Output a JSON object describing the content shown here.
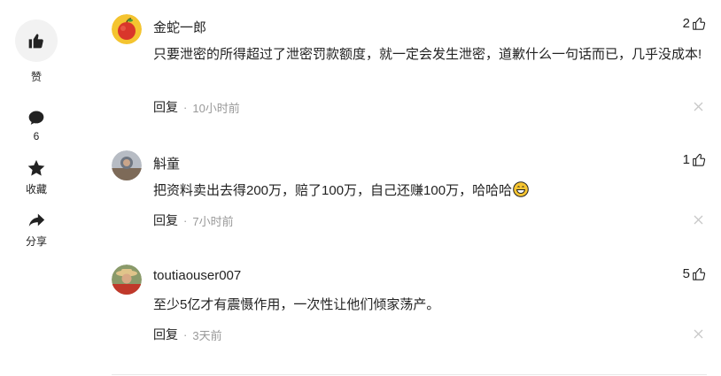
{
  "rail": {
    "like_label": "赞",
    "comment_count": "6",
    "favorite_label": "收藏",
    "share_label": "分享"
  },
  "comments": [
    {
      "user": "金蛇一郎",
      "likes": "2",
      "text": "只要泄密的所得超过了泄密罚款额度，就一定会发生泄密，道歉什么一句话而已，几乎没成本!",
      "reply_label": "回复",
      "time": "10小时前"
    },
    {
      "user": "斛童",
      "likes": "1",
      "text": "把资料卖出去得200万，赔了100万，自己还赚100万，哈哈哈",
      "reply_label": "回复",
      "time": "7小时前"
    },
    {
      "user": "toutiaouser007",
      "likes": "5",
      "text": "至少5亿才有震慑作用，一次性让他们倾家荡产。",
      "reply_label": "回复",
      "time": "3天前"
    }
  ],
  "colors": {
    "text": "#222222",
    "muted": "#999999",
    "rail_bg": "#f2f2f2"
  }
}
